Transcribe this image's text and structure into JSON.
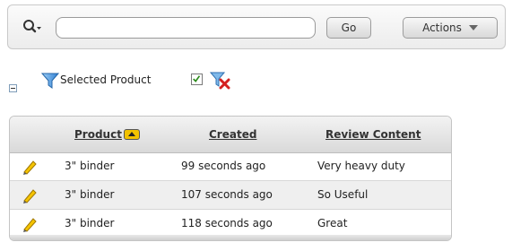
{
  "toolbar": {
    "search_value": "",
    "go_label": "Go",
    "actions_label": "Actions"
  },
  "filter": {
    "label": "Selected Product",
    "checked": true
  },
  "report": {
    "columns": [
      "Product",
      "Created",
      "Review Content"
    ],
    "sort_column": "Product",
    "sort_direction": "ascending",
    "rows": [
      {
        "product": "3\" binder",
        "created": "99 seconds ago",
        "review": "Very heavy duty"
      },
      {
        "product": "3\" binder",
        "created": "107 seconds ago",
        "review": "So Useful"
      },
      {
        "product": "3\" binder",
        "created": "118 seconds ago",
        "review": "Great"
      }
    ]
  },
  "colors": {
    "sort_accent": "#f2c200",
    "check_green": "#2a8a1a",
    "remove_red": "#d42020",
    "funnel_blue": "#2f7fd3"
  }
}
